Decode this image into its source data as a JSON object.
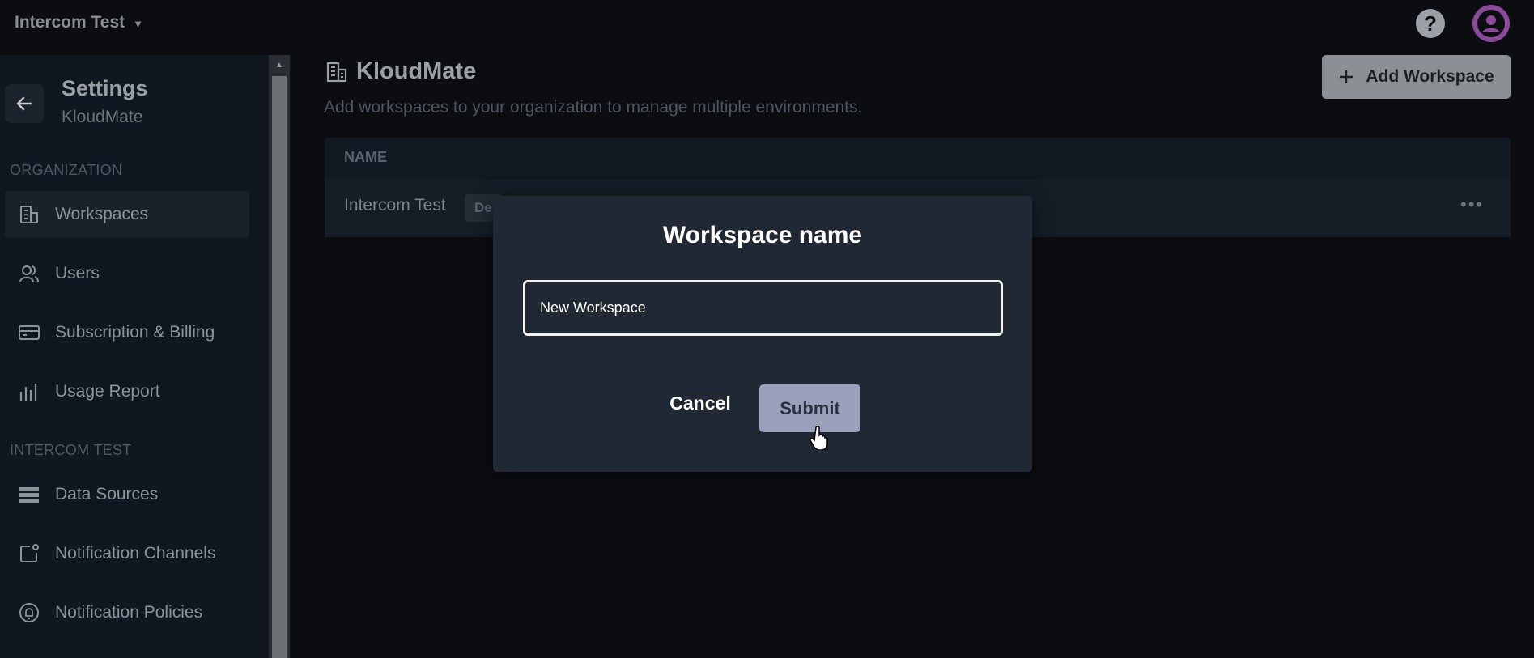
{
  "topbar": {
    "org_name": "Intercom Test",
    "help_label": "?"
  },
  "sidebar": {
    "title": "Settings",
    "subtitle": "KloudMate",
    "sections": [
      {
        "heading": "ORGANIZATION"
      },
      {
        "heading": "INTERCOM TEST"
      }
    ],
    "items": [
      {
        "label": "Workspaces",
        "icon": "building-icon",
        "active": true
      },
      {
        "label": "Users",
        "icon": "users-icon"
      },
      {
        "label": "Subscription & Billing",
        "icon": "credit-card-icon"
      },
      {
        "label": "Usage Report",
        "icon": "bar-chart-icon"
      },
      {
        "label": "Data Sources",
        "icon": "server-stack-icon"
      },
      {
        "label": "Notification Channels",
        "icon": "notification-channel-icon"
      },
      {
        "label": "Notification Policies",
        "icon": "bell-icon"
      }
    ]
  },
  "main": {
    "title": "KloudMate",
    "description": "Add workspaces to your organization to manage multiple environments.",
    "add_button_label": "Add Workspace",
    "table": {
      "header": "NAME",
      "rows": [
        {
          "name": "Intercom Test",
          "badge": "De"
        }
      ],
      "row_menu": "•••"
    }
  },
  "dialog": {
    "title": "Workspace name",
    "input_value": "New Workspace",
    "cancel_label": "Cancel",
    "submit_label": "Submit"
  },
  "colors": {
    "background": "#0b0d10",
    "sidebar": "#111720",
    "dialog": "#202833",
    "submit": "#9aa1bb",
    "avatar": "#8a4b9a"
  }
}
